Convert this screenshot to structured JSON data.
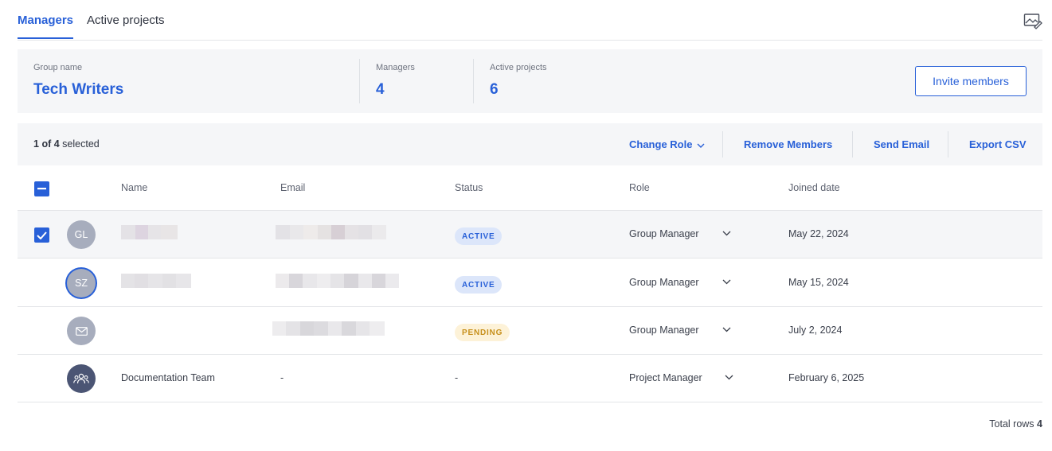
{
  "tabs": [
    {
      "label": "Managers",
      "active": true
    },
    {
      "label": "Active projects",
      "active": false
    }
  ],
  "summary": {
    "group_label": "Group name",
    "group_name": "Tech Writers",
    "managers_label": "Managers",
    "managers_count": "4",
    "projects_label": "Active projects",
    "projects_count": "6",
    "invite_label": "Invite members"
  },
  "actionbar": {
    "selected": "1",
    "of": "of",
    "total": "4",
    "selected_word": "selected",
    "change_role": "Change Role",
    "remove_members": "Remove Members",
    "send_email": "Send Email",
    "export_csv": "Export CSV"
  },
  "table": {
    "headers": {
      "name": "Name",
      "email": "Email",
      "status": "Status",
      "role": "Role",
      "joined": "Joined date"
    },
    "rows": [
      {
        "initials": "GL",
        "name": "",
        "email": "",
        "status": "ACTIVE",
        "role": "Group Manager",
        "joined": "May 22, 2024",
        "selected": true
      },
      {
        "initials": "SZ",
        "name": "",
        "email": "",
        "status": "ACTIVE",
        "role": "Group Manager",
        "joined": "May 15, 2024",
        "selected": false
      },
      {
        "initials": "",
        "name": "",
        "email": "",
        "status": "PENDING",
        "role": "Group Manager",
        "joined": "July 2, 2024",
        "selected": false
      },
      {
        "initials": "",
        "name": "Documentation Team",
        "email": "-",
        "status": "-",
        "role": "Project Manager",
        "joined": "February 6, 2025",
        "selected": false
      }
    ]
  },
  "footer": {
    "total_label": "Total rows",
    "total_value": "4"
  },
  "colors": {
    "accent": "#2860d8",
    "panel": "#f5f6f8",
    "avatar": "#a7adbd",
    "team_avatar": "#4b5574",
    "active_badge_bg": "#dce6fa",
    "pending_badge_bg": "#fdf2d8",
    "pending_text": "#c7901c"
  },
  "icons": {
    "edit": "edit-image-icon",
    "chevron": "chevron-down-icon",
    "mail": "mail-icon",
    "team": "team-icon",
    "check": "check-icon",
    "minus": "minus-icon"
  }
}
